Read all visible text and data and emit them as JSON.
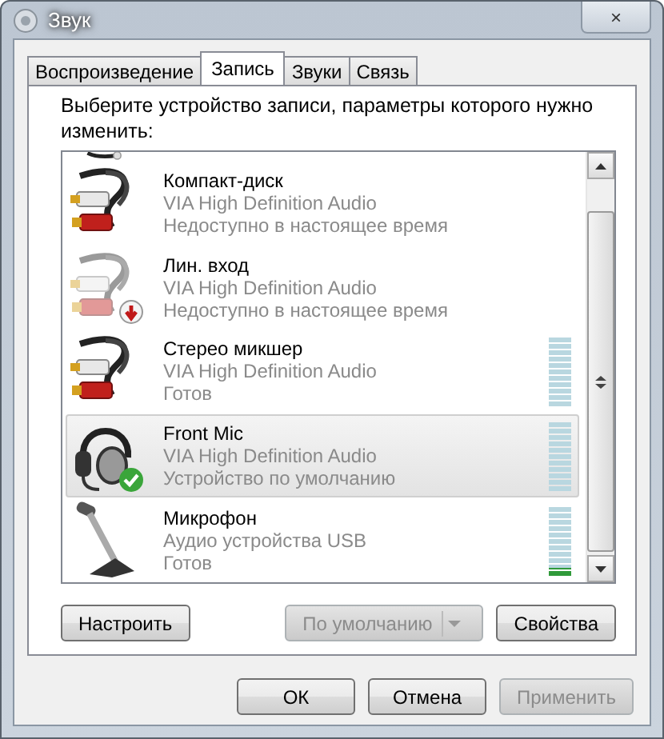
{
  "window": {
    "title": "Звук",
    "close": "×"
  },
  "tabs": [
    {
      "label": "Воспроизведение",
      "selected": false
    },
    {
      "label": "Запись",
      "selected": true
    },
    {
      "label": "Звуки",
      "selected": false
    },
    {
      "label": "Связь",
      "selected": false
    }
  ],
  "instruction": "Выберите устройство записи, параметры которого нужно изменить:",
  "devices": [
    {
      "kind": "cable",
      "name": "Компакт-диск",
      "driver": "VIA High Definition Audio",
      "status": "Недоступно в настоящее время",
      "faded": false,
      "unplugged": false,
      "default": false,
      "selected": false
    },
    {
      "kind": "cable",
      "name": "Лин. вход",
      "driver": "VIA High Definition Audio",
      "status": "Недоступно в настоящее время",
      "faded": true,
      "unplugged": true,
      "default": false,
      "selected": false
    },
    {
      "kind": "cable",
      "name": "Стерео микшер",
      "driver": "VIA High Definition Audio",
      "status": "Готов",
      "faded": false,
      "unplugged": false,
      "default": false,
      "selected": false,
      "level": 0
    },
    {
      "kind": "headset",
      "name": "Front Mic",
      "driver": "VIA High Definition Audio",
      "status": "Устройство по умолчанию",
      "faded": false,
      "unplugged": false,
      "default": true,
      "selected": true,
      "level": 0
    },
    {
      "kind": "microphone",
      "name": "Микрофон",
      "driver": "Аудио устройства USB",
      "status": "Готов",
      "faded": false,
      "unplugged": false,
      "default": false,
      "selected": false,
      "level": 0.1
    }
  ],
  "panel_buttons": [
    {
      "label": "Настроить",
      "disabled": false,
      "dropdown": false
    },
    {
      "label": "По умолчанию",
      "disabled": true,
      "dropdown": true
    },
    {
      "label": "Свойства",
      "disabled": false,
      "dropdown": false
    }
  ],
  "dialog_buttons": [
    {
      "label": "ОК",
      "disabled": false
    },
    {
      "label": "Отмена",
      "disabled": false
    },
    {
      "label": "Применить",
      "disabled": true
    }
  ]
}
